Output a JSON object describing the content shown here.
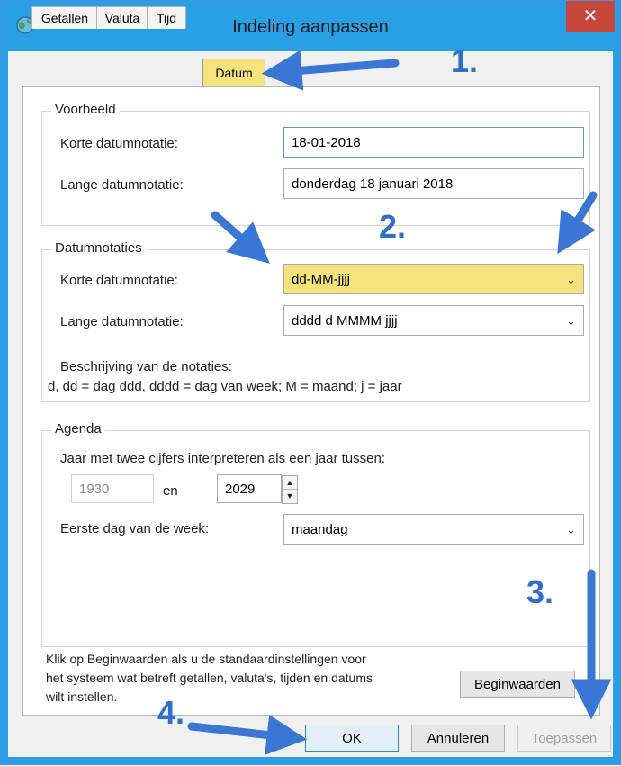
{
  "window": {
    "title": "Indeling aanpassen",
    "close_label": "✕"
  },
  "tabs": [
    {
      "label": "Getallen"
    },
    {
      "label": "Valuta"
    },
    {
      "label": "Tijd"
    },
    {
      "label": "Datum"
    }
  ],
  "voorbeeld": {
    "legend": "Voorbeeld",
    "short_label": "Korte datumnotatie:",
    "short_value": "18-01-2018",
    "long_label": "Lange datumnotatie:",
    "long_value": "donderdag 18 januari 2018"
  },
  "datumnotaties": {
    "legend": "Datumnotaties",
    "short_label": "Korte datumnotatie:",
    "short_value": "dd-MM-jjjj",
    "long_label": "Lange datumnotatie:",
    "long_value": "dddd d MMMM jjjj",
    "desc_title": "Beschrijving van de notaties:",
    "desc_text": "d, dd = dag  ddd, dddd = dag van week;  M = maand;  j = jaar"
  },
  "agenda": {
    "legend": "Agenda",
    "interpret_label": "Jaar met twee cijfers interpreteren als een jaar tussen:",
    "year_from": "1930",
    "en_label": "en",
    "year_to": "2029",
    "first_day_label": "Eerste dag van de week:",
    "first_day_value": "maandag"
  },
  "footer": {
    "note": [
      "Klik op Beginwaarden als u de standaardinstellingen voor",
      "het systeem wat betreft getallen, valuta's, tijden en datums",
      "wilt instellen."
    ],
    "reset_label": "Beginwaarden",
    "ok_label": "OK",
    "cancel_label": "Annuleren",
    "apply_label": "Toepassen"
  },
  "annotations": {
    "n1": "1.",
    "n2": "2.",
    "n3": "3.",
    "n4": "4.",
    "color": "#2f6fc9"
  },
  "colors": {
    "titlebar": "#29a0e6",
    "close": "#c7463a",
    "highlight": "#f5e27a"
  }
}
